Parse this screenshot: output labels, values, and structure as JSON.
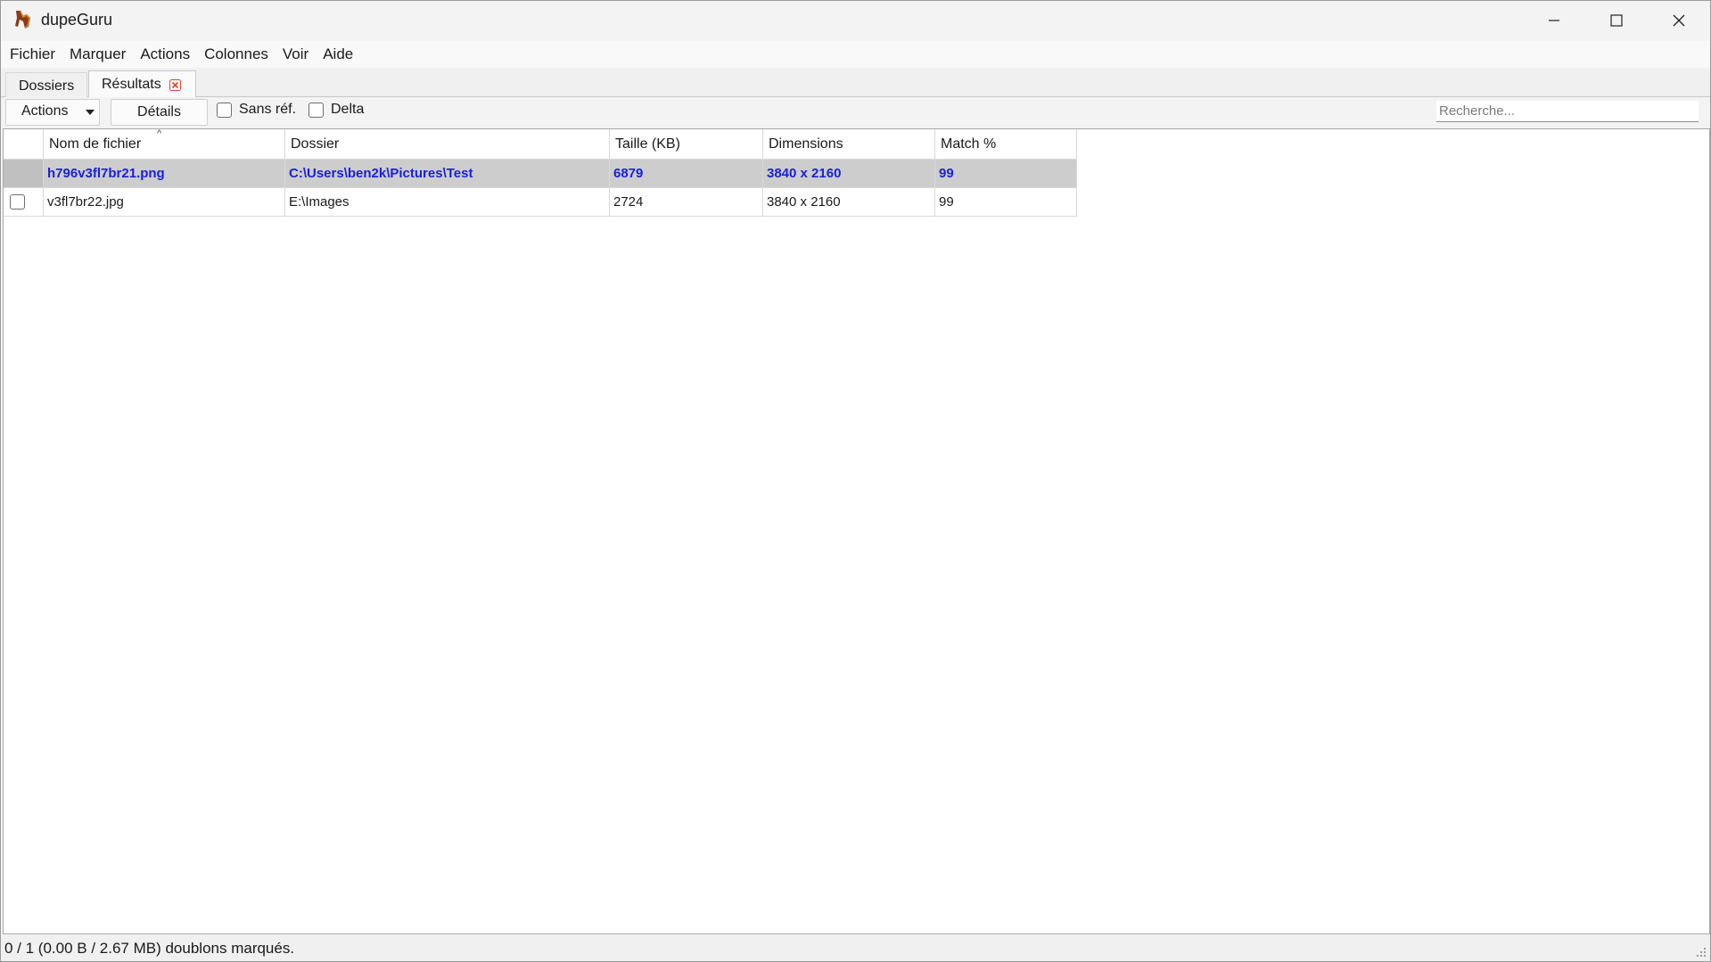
{
  "window": {
    "title": "dupeGuru"
  },
  "menubar": {
    "items": [
      "Fichier",
      "Marquer",
      "Actions",
      "Colonnes",
      "Voir",
      "Aide"
    ]
  },
  "tabs": {
    "dossiers": "Dossiers",
    "resultats": "Résultats"
  },
  "toolbar": {
    "actions_label": "Actions",
    "details_label": "Détails",
    "sans_ref_label": "Sans réf.",
    "delta_label": "Delta",
    "search_placeholder": "Recherche..."
  },
  "table": {
    "columns": [
      "Nom de fichier",
      "Dossier",
      "Taille (KB)",
      "Dimensions",
      "Match %"
    ],
    "rows": [
      {
        "reference": true,
        "name": "h796v3fl7br21.png",
        "folder": "C:\\Users\\ben2k\\Pictures\\Test",
        "size": "6879",
        "dimensions": "3840 x 2160",
        "match": "99"
      },
      {
        "reference": false,
        "name": "v3fl7br22.jpg",
        "folder": "E:\\Images",
        "size": "2724",
        "dimensions": "3840 x 2160",
        "match": "99"
      }
    ]
  },
  "status": {
    "text": "0 / 1 (0.00 B / 2.67 MB) doublons marqués."
  },
  "colors": {
    "reference_text": "#1a1fd6",
    "reference_bg": "#cdcdcd",
    "tab_close_accent": "#e0462e"
  }
}
